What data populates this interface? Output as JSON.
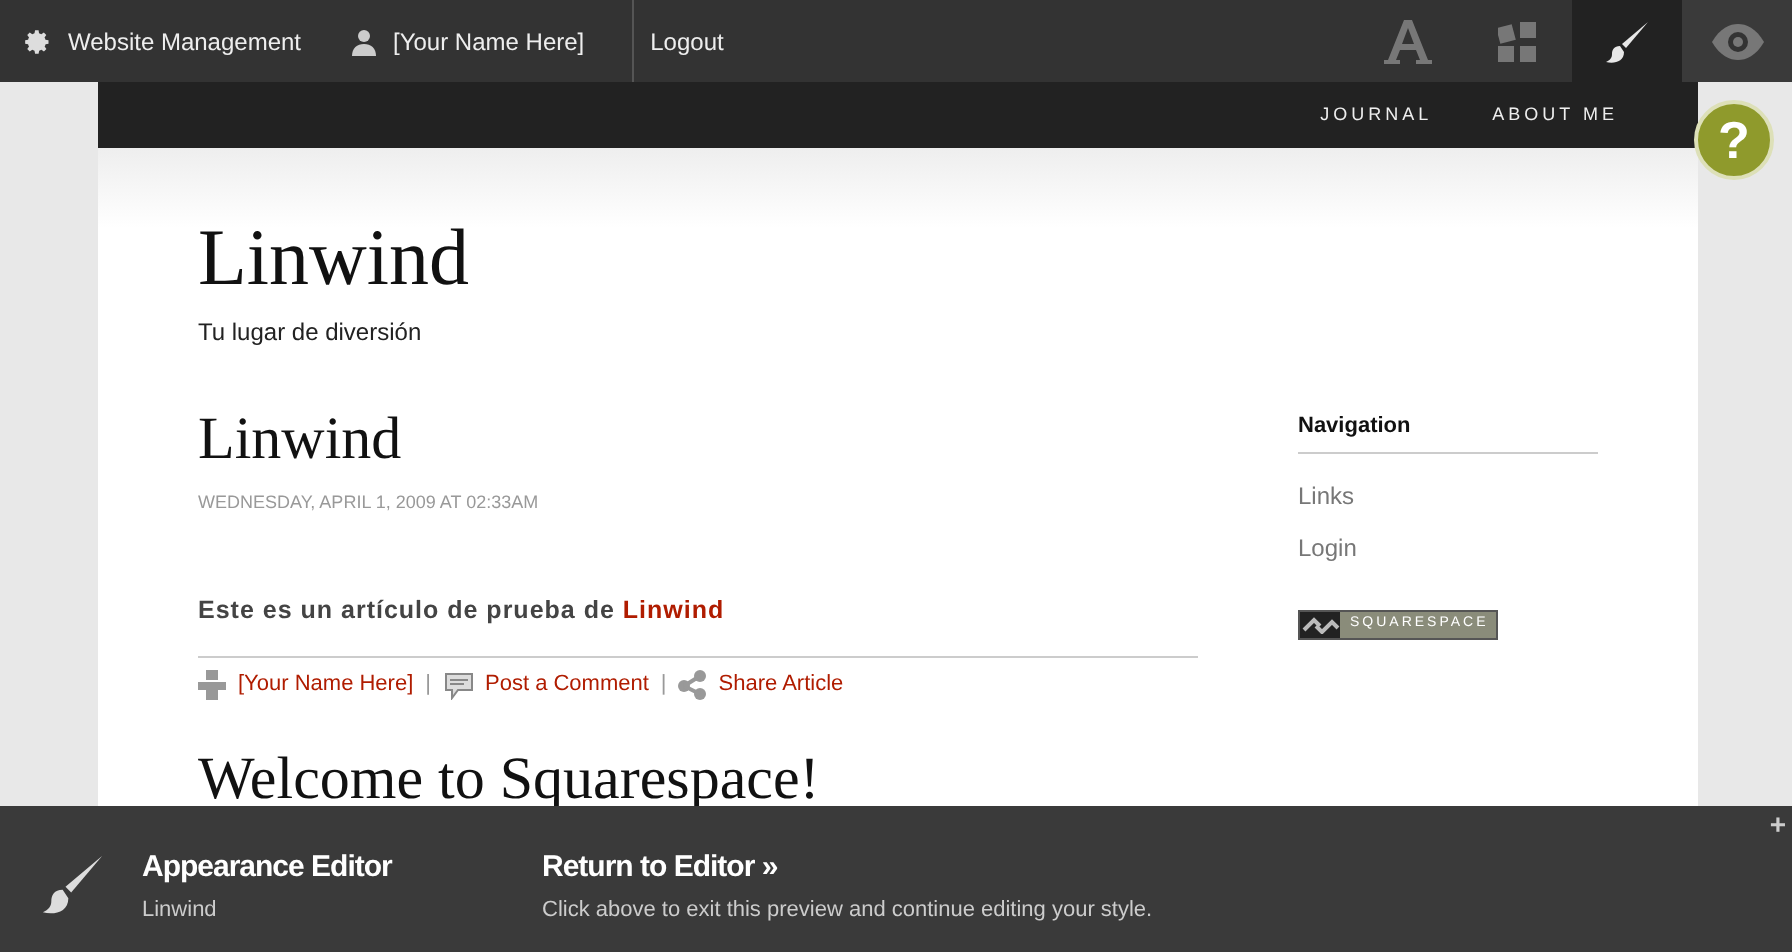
{
  "top_bar": {
    "items": [
      {
        "kind": "gear",
        "label": "Website Management"
      },
      {
        "kind": "user",
        "label": "[Your Name Here]"
      },
      {
        "kind": "plain",
        "label": "Logout"
      }
    ],
    "tools": [
      {
        "kind": "type",
        "selected": false
      },
      {
        "kind": "blocks",
        "selected": false
      },
      {
        "kind": "brush",
        "selected": true
      },
      {
        "kind": "eye",
        "selected": false
      }
    ]
  },
  "site_nav": [
    {
      "label": "JOURNAL"
    },
    {
      "label": "ABOUT ME"
    }
  ],
  "help": {
    "label": "?"
  },
  "site": {
    "title": "Linwind",
    "tagline": "Tu lugar de diversión"
  },
  "post": {
    "title": "Linwind",
    "date": "WEDNESDAY, APRIL 1, 2009 AT 02:33AM",
    "body": "Este es un artículo de prueba de ",
    "body_link": "Linwind",
    "meta": [
      {
        "kind": "author",
        "label": "[Your Name Here]"
      },
      {
        "kind": "comment",
        "label": "Post a Comment"
      },
      {
        "kind": "share",
        "label": "Share Article"
      }
    ],
    "separator": "|"
  },
  "post2": {
    "title": "Welcome to Squarespace!"
  },
  "sidebar": {
    "heading": "Navigation",
    "links": [
      "Links",
      "Login"
    ],
    "badge": "SQUARESPACE"
  },
  "editor_bar": {
    "title": "Appearance Editor",
    "subtitle": "Linwind",
    "action": "Return to Editor »",
    "hint": "Click above to exit this preview and continue editing your style.",
    "expand": "+"
  }
}
